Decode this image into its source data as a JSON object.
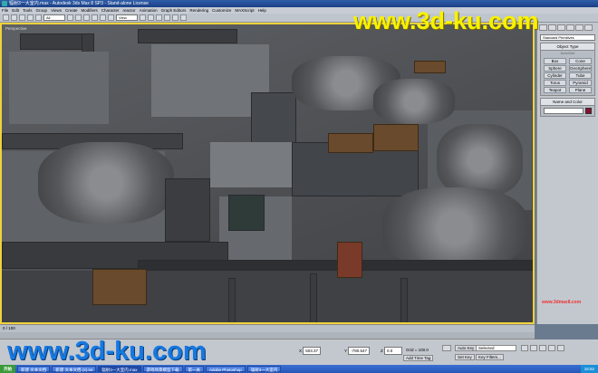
{
  "window": {
    "title": "辐射3一大室内.max - Autodesk 3ds Max 8 SP3 - Stand-alone License"
  },
  "menu": [
    "File",
    "Edit",
    "Tools",
    "Group",
    "Views",
    "Create",
    "Modifiers",
    "Character",
    "reactor",
    "Animation",
    "Graph Editors",
    "Rendering",
    "Customize",
    "MAXScript",
    "Help"
  ],
  "toolbar": {
    "selection_filter": "All",
    "ref_coord": "View"
  },
  "viewport": {
    "label": "Perspective"
  },
  "watermarks": {
    "top": "www.3d-ku.com",
    "bottom": "www.3d-ku.com",
    "corner": "www.3dmax8.com"
  },
  "command_panel": {
    "category": "Standard Primitives",
    "object_type_title": "Object Type",
    "autogrid": "AutoGrid",
    "buttons": [
      "Box",
      "Cone",
      "Sphere",
      "GeoSphere",
      "Cylinder",
      "Tube",
      "Torus",
      "Pyramid",
      "Teapot",
      "Plane"
    ],
    "name_color_title": "Name and Color",
    "swatch_color": "#8a1030"
  },
  "time": {
    "frame": "0 / 100"
  },
  "status": {
    "x_label": "X",
    "x_value": "503.37",
    "y_label": "Y",
    "y_value": "-780.647",
    "z_label": "Z",
    "z_value": "0.0",
    "grid": "Grid = 100.0",
    "add_time_tag": "Add Time Tag",
    "auto_key": "Auto Key",
    "set_key": "Set Key",
    "selected": "Selected",
    "key_filters": "Key Filters..."
  },
  "taskbar": {
    "start": "开始",
    "tasks": [
      "新建 文本文档",
      "新建 文本文档 (2).txt",
      "辐射3一大室内.max",
      "游戏场景模型下载",
      "第一关",
      "Adobe Photoshop",
      "辐射3一大室内"
    ],
    "clock": "16:52"
  }
}
